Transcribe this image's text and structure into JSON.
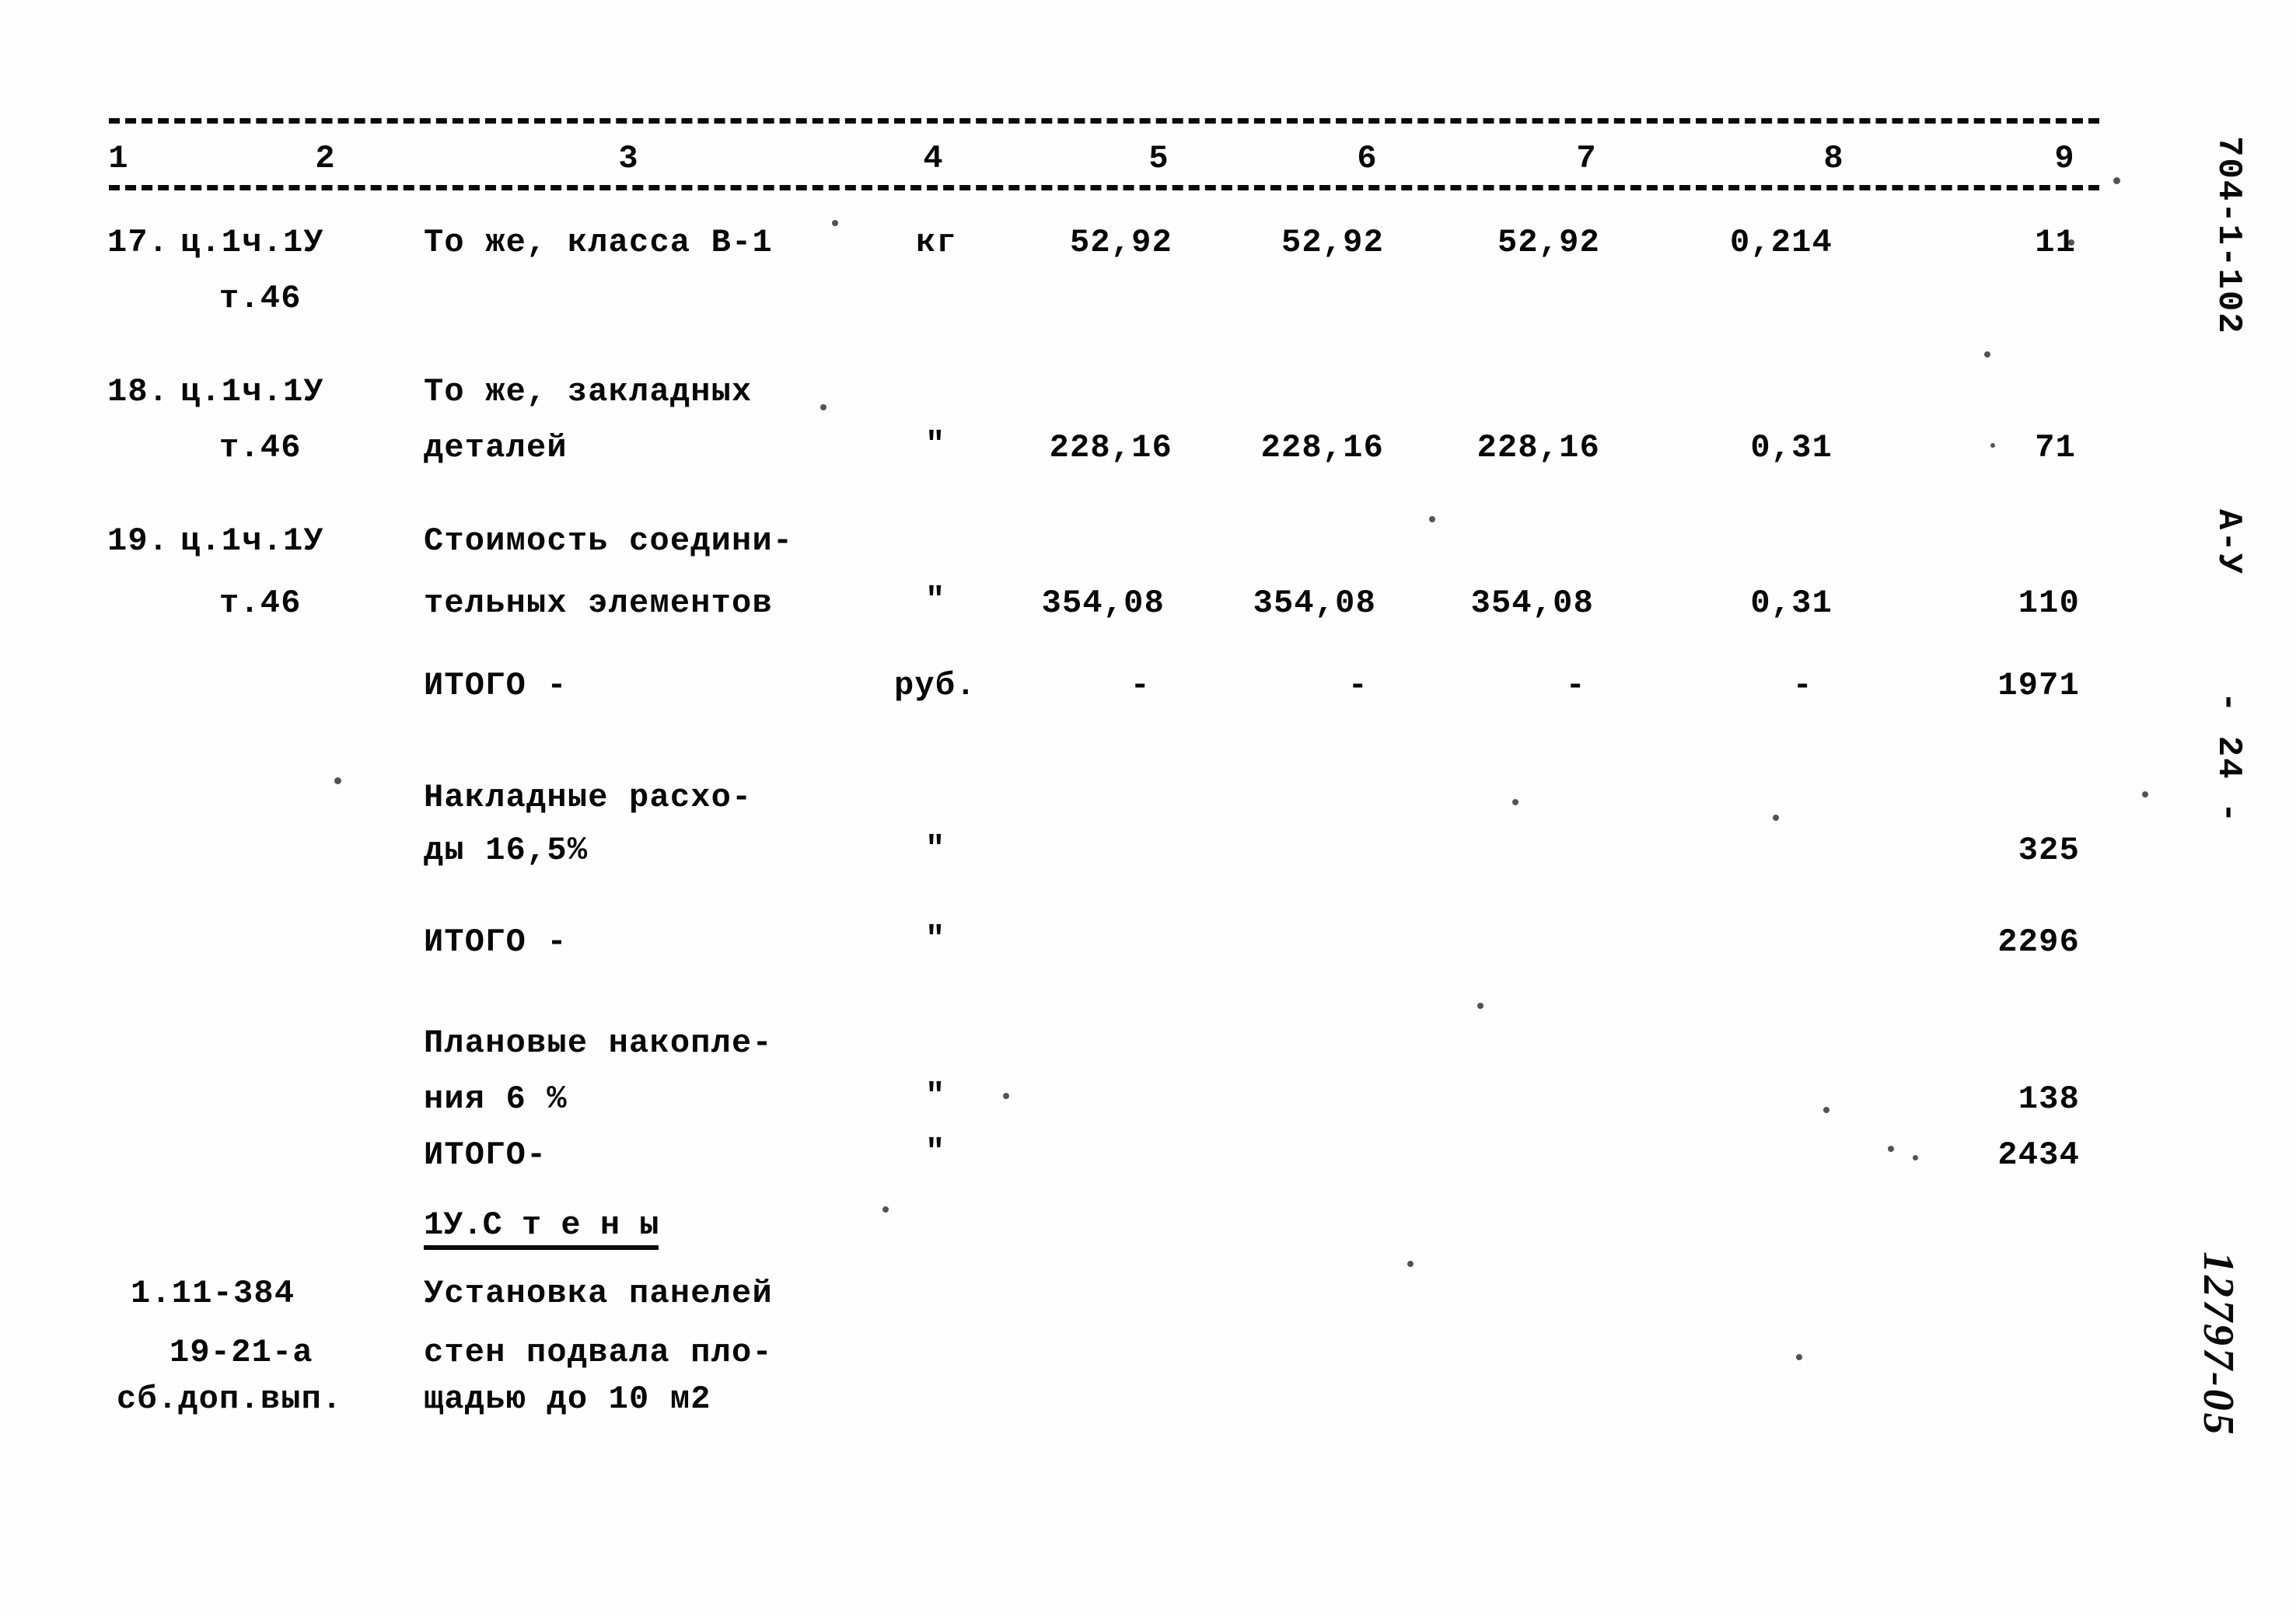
{
  "document": {
    "type": "soviet-construction-estimate-table",
    "margin_stamp_code": "704-1-102",
    "margin_stamp_section": "А-У",
    "page_marker": "- 24 -",
    "handwritten_archive_number": "12797-05"
  },
  "table": {
    "column_numbers": [
      "1",
      "2",
      "3",
      "4",
      "5",
      "6",
      "7",
      "8",
      "9"
    ],
    "rows": [
      {
        "no": "17.",
        "code_line1": "ц.1ч.1У",
        "code_line2": "т.46",
        "desc_line1": "То же, класса В-1",
        "desc_line2": "",
        "unit": "кг",
        "c5": "52,92",
        "c6": "52,92",
        "c7": "52,92",
        "c8": "0,214",
        "c9": "11"
      },
      {
        "no": "18.",
        "code_line1": "ц.1ч.1У",
        "code_line2": "т.46",
        "desc_line1": "То же, закладных",
        "desc_line2": "деталей",
        "unit": "\"",
        "c5": "228,16",
        "c6": "228,16",
        "c7": "228,16",
        "c8": "0,31",
        "c9": "71"
      },
      {
        "no": "19.",
        "code_line1": "ц.1ч.1У",
        "code_line2": "т.46",
        "desc_line1": "Стоимость соедини-",
        "desc_line2": "тельных элементов",
        "unit": "\"",
        "c5": "354,08",
        "c6": "354,08",
        "c7": "354,08",
        "c8": "0,31",
        "c9": "110"
      },
      {
        "no": "",
        "code_line1": "",
        "code_line2": "",
        "desc_line1": "ИТОГО -",
        "desc_line2": "",
        "unit": "руб.",
        "c5": "-",
        "c6": "-",
        "c7": "-",
        "c8": "-",
        "c9": "1971"
      },
      {
        "no": "",
        "code_line1": "",
        "code_line2": "",
        "desc_line1": "Накладные расхо-",
        "desc_line2": "ды 16,5%",
        "unit": "\"",
        "c5": "",
        "c6": "",
        "c7": "",
        "c8": "",
        "c9": "325"
      },
      {
        "no": "",
        "code_line1": "",
        "code_line2": "",
        "desc_line1": "ИТОГО -",
        "desc_line2": "",
        "unit": "\"",
        "c5": "",
        "c6": "",
        "c7": "",
        "c8": "",
        "c9": "2296"
      },
      {
        "no": "",
        "code_line1": "",
        "code_line2": "",
        "desc_line1": "Плановые накопле-",
        "desc_line2": "ния 6 %",
        "unit": "\"",
        "c5": "",
        "c6": "",
        "c7": "",
        "c8": "",
        "c9": "138"
      },
      {
        "no": "",
        "code_line1": "",
        "code_line2": "",
        "desc_line1": "ИТОГО-",
        "desc_line2": "",
        "unit": "\"",
        "c5": "",
        "c6": "",
        "c7": "",
        "c8": "",
        "c9": "2434"
      }
    ],
    "section_heading": "1У.С т е н ы",
    "final_entry": {
      "code_line1": "1.11-384",
      "code_line2": "19-21-а",
      "code_line3": "сб.доп.вып.",
      "desc_line1": "Установка панелей",
      "desc_line2": "стен подвала пло-",
      "desc_line3": "щадью до 10 м2"
    }
  }
}
